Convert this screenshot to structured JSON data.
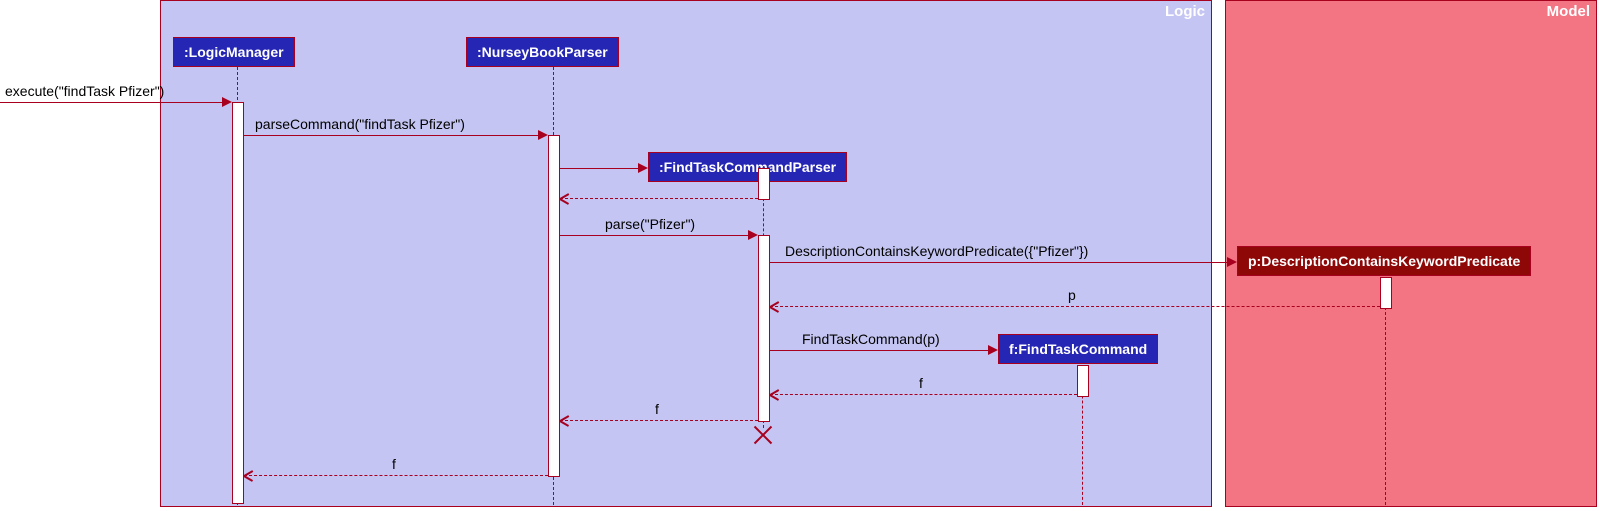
{
  "frames": {
    "logic": "Logic",
    "model": "Model"
  },
  "participants": {
    "logicManager": ":LogicManager",
    "nurseyBookParser": ":NurseyBookParser",
    "findTaskCommandParser": ":FindTaskCommandParser",
    "predicate": "p:DescriptionContainsKeywordPredicate",
    "findTaskCommand": "f:FindTaskCommand"
  },
  "messages": {
    "execute": "execute(\"findTask Pfizer\")",
    "parseCommand": "parseCommand(\"findTask Pfizer\")",
    "parse": "parse(\"Pfizer\")",
    "predicateCtor": "DescriptionContainsKeywordPredicate({\"Pfizer\"})",
    "returnP": "p",
    "findTaskCmdCtor": "FindTaskCommand(p)",
    "returnF1": "f",
    "returnF2": "f",
    "returnF3": "f"
  },
  "chart_data": {
    "type": "sequence-diagram",
    "frames": [
      {
        "name": "Logic",
        "participants": [
          ":LogicManager",
          ":NurseyBookParser",
          ":FindTaskCommandParser",
          "f:FindTaskCommand"
        ]
      },
      {
        "name": "Model",
        "participants": [
          "p:DescriptionContainsKeywordPredicate"
        ]
      }
    ],
    "messages": [
      {
        "from": "(caller)",
        "to": ":LogicManager",
        "label": "execute(\"findTask Pfizer\")",
        "type": "sync"
      },
      {
        "from": ":LogicManager",
        "to": ":NurseyBookParser",
        "label": "parseCommand(\"findTask Pfizer\")",
        "type": "sync"
      },
      {
        "from": ":NurseyBookParser",
        "to": ":FindTaskCommandParser",
        "label": "",
        "type": "create"
      },
      {
        "from": ":FindTaskCommandParser",
        "to": ":NurseyBookParser",
        "label": "",
        "type": "return"
      },
      {
        "from": ":NurseyBookParser",
        "to": ":FindTaskCommandParser",
        "label": "parse(\"Pfizer\")",
        "type": "sync"
      },
      {
        "from": ":FindTaskCommandParser",
        "to": "p:DescriptionContainsKeywordPredicate",
        "label": "DescriptionContainsKeywordPredicate({\"Pfizer\"})",
        "type": "create"
      },
      {
        "from": "p:DescriptionContainsKeywordPredicate",
        "to": ":FindTaskCommandParser",
        "label": "p",
        "type": "return"
      },
      {
        "from": ":FindTaskCommandParser",
        "to": "f:FindTaskCommand",
        "label": "FindTaskCommand(p)",
        "type": "create"
      },
      {
        "from": "f:FindTaskCommand",
        "to": ":FindTaskCommandParser",
        "label": "f",
        "type": "return"
      },
      {
        "from": ":FindTaskCommandParser",
        "to": ":NurseyBookParser",
        "label": "f",
        "type": "return",
        "destroy": ":FindTaskCommandParser"
      },
      {
        "from": ":NurseyBookParser",
        "to": ":LogicManager",
        "label": "f",
        "type": "return"
      }
    ]
  }
}
